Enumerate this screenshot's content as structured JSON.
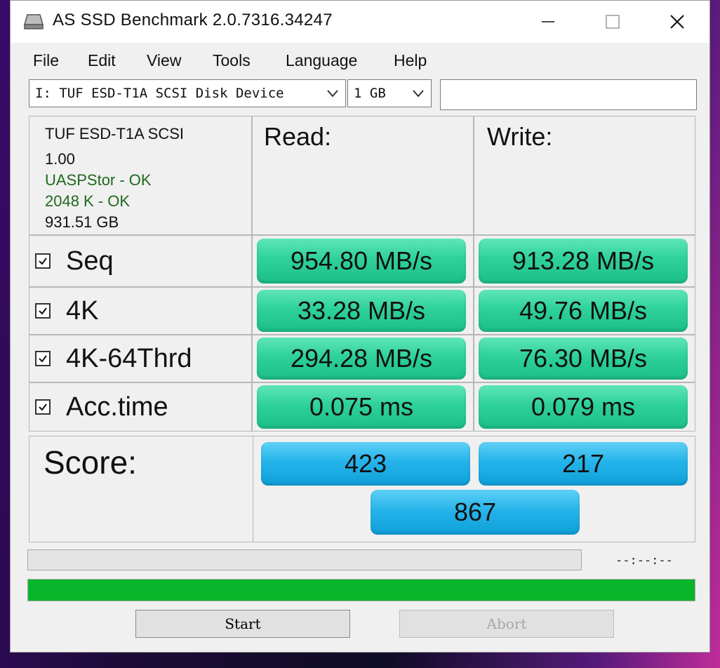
{
  "window": {
    "title": "AS SSD Benchmark 2.0.7316.34247",
    "minimize_icon": "minimize-icon",
    "maximize_icon": "maximize-icon",
    "close_icon": "close-icon"
  },
  "menu": [
    "File",
    "Edit",
    "View",
    "Tools",
    "Language",
    "Help"
  ],
  "drive_select": {
    "value": "I: TUF ESD-T1A SCSI Disk Device"
  },
  "size_select": {
    "value": "1 GB"
  },
  "extra_field": {
    "value": ""
  },
  "drive_info": {
    "name": "TUF ESD-T1A SCSI",
    "firmware": "1.00",
    "driver": "UASPStor - OK",
    "alignment": "2048 K - OK",
    "capacity": "931.51 GB"
  },
  "headers": {
    "read": "Read:",
    "write": "Write:"
  },
  "rows": [
    {
      "label": "Seq",
      "checked": true,
      "read": "954.80 MB/s",
      "write": "913.28 MB/s"
    },
    {
      "label": "4K",
      "checked": true,
      "read": "33.28 MB/s",
      "write": "49.76 MB/s"
    },
    {
      "label": "4K-64Thrd",
      "checked": true,
      "read": "294.28 MB/s",
      "write": "76.30 MB/s"
    },
    {
      "label": "Acc.time",
      "checked": true,
      "read": "0.075 ms",
      "write": "0.079 ms"
    }
  ],
  "score": {
    "label": "Score:",
    "read": "423",
    "write": "217",
    "total": "867"
  },
  "progress": {
    "test_progress": 0,
    "total_progress": 1.0,
    "time": "--:--:--"
  },
  "buttons": {
    "start": "Start",
    "abort": "Abort"
  },
  "colors": {
    "result_green": "#2ed19a",
    "score_blue": "#25b4ea",
    "progress_green": "#09b52a",
    "ok_text": "#1e6a1e"
  }
}
